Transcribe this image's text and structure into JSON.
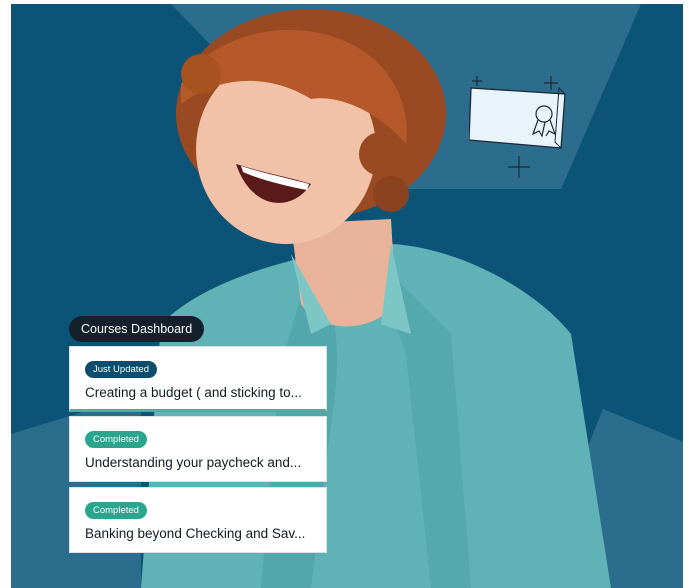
{
  "dashboard": {
    "label": "Courses Dashboard",
    "courses": [
      {
        "status": "Just Updated",
        "title": "Creating a budget ( and sticking to..."
      },
      {
        "status": "Completed",
        "title": "Understanding your paycheck and..."
      },
      {
        "status": "Completed",
        "title": "Banking beyond Checking and Sav..."
      }
    ]
  },
  "colors": {
    "background": "#0b5478",
    "accent_panel": "#2c6d8d",
    "status_updated": "#0c4c6c",
    "status_completed": "#2aa58e"
  },
  "icons": [
    "certificate-icon",
    "award-ribbon-icon",
    "sparkle-plus-icon"
  ]
}
